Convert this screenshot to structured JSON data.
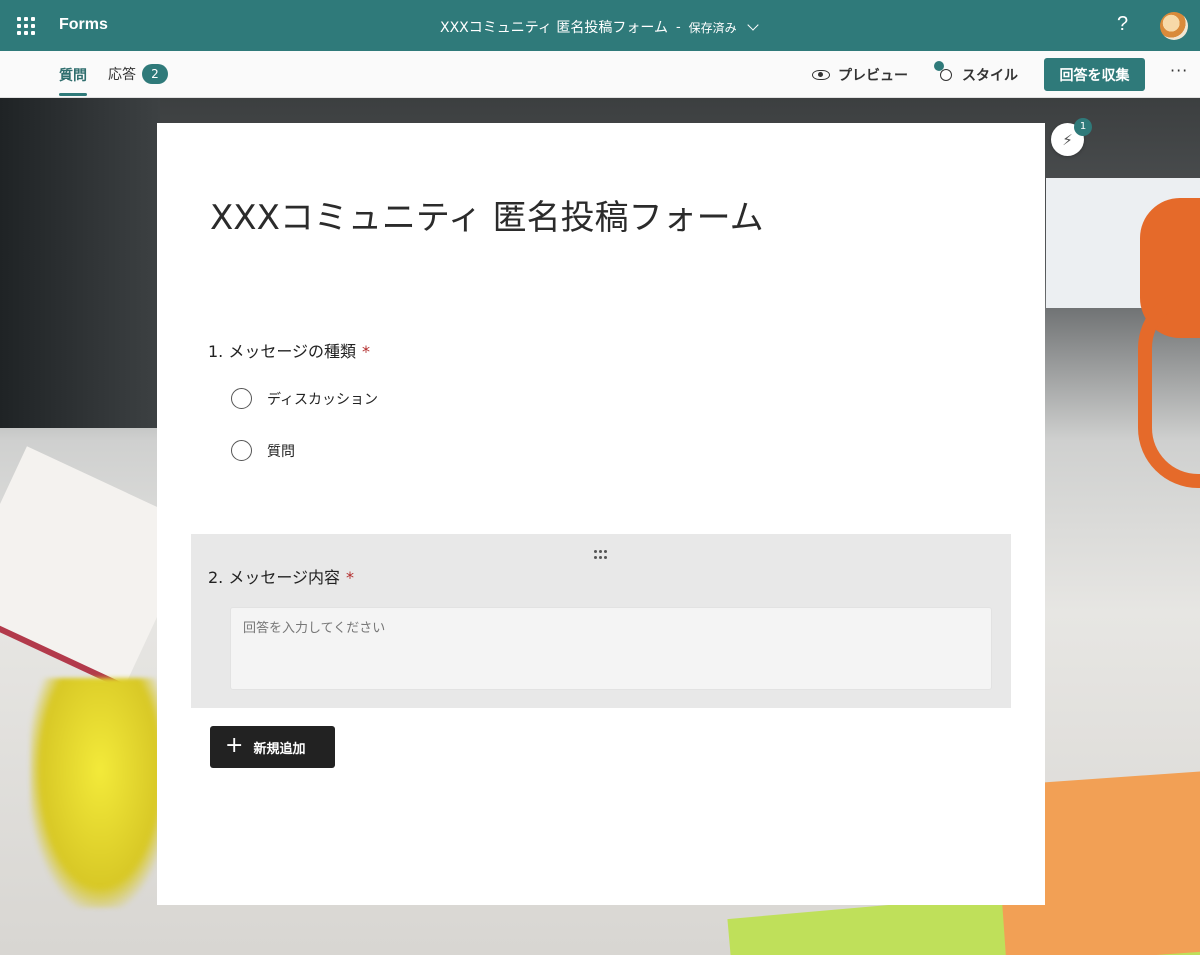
{
  "app": {
    "name": "Forms"
  },
  "header": {
    "doc_title": "XXXコミュニティ 匿名投稿フォーム",
    "separator": "-",
    "save_status": "保存済み",
    "help": "?"
  },
  "toolbar": {
    "tabs": [
      {
        "label": "質問"
      },
      {
        "label": "応答"
      }
    ],
    "responses_count": "2",
    "preview_label": "プレビュー",
    "style_label": "スタイル",
    "collect_label": "回答を収集",
    "more_label": "···"
  },
  "insights": {
    "badge": "1"
  },
  "form": {
    "title": "XXXコミュニティ 匿名投稿フォーム",
    "questions": [
      {
        "label": "1. メッセージの種類",
        "required_mark": "*",
        "options": [
          "ディスカッション",
          "質問"
        ]
      },
      {
        "label": "2. メッセージ内容",
        "required_mark": "*",
        "placeholder": "回答を入力してください"
      }
    ],
    "add_new_label": "新規追加",
    "add_new_icon": "+"
  },
  "colors": {
    "accent": "#2f7a7a",
    "required": "#b22b2b"
  },
  "icons": {
    "app_launcher": "waffle-icon",
    "preview": "eye-icon",
    "style": "palette-icon",
    "insights": "lightning-icon",
    "drag": "drag-handle-icon",
    "add": "plus-icon"
  }
}
